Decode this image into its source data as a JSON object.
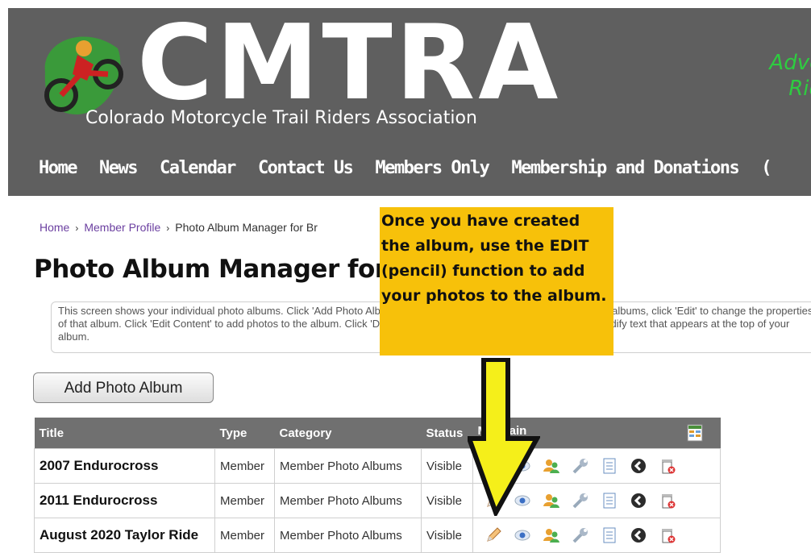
{
  "header": {
    "logo_text": "CMTRA",
    "logo_subtitle": "Colorado Motorcycle Trail Riders Association",
    "tagline_line1": "Advo",
    "tagline_line2": "Rid",
    "colors": {
      "header_bg": "#5f5f5f",
      "tagline": "#2ecc40"
    }
  },
  "nav": {
    "items": [
      "Home",
      "News",
      "Calendar",
      "Contact Us",
      "Members Only",
      "Membership and Donations",
      "("
    ]
  },
  "breadcrumb": {
    "home": "Home",
    "profile": "Member Profile",
    "current": "Photo Album Manager for Br"
  },
  "page_title": "Photo Album Manager for B",
  "description": "This screen shows your individual photo albums. Click 'Add Photo Album' to add a new photo album. In the list of photo albums, click 'Edit' to change the properties of that album. Click 'Edit Content' to add photos to the album. Click 'Delete' to delete an album. Click 'Description' to modify text that appears at the top of your album.",
  "callout": {
    "text": "Once you have created the album, use the EDIT (pencil) function to add your photos to the album.",
    "color": "#f7c10a"
  },
  "add_button": "Add Photo Album",
  "table": {
    "headers": {
      "title": "Title",
      "type": "Type",
      "category": "Category",
      "status": "Status",
      "maintain": "Maintain"
    },
    "rows": [
      {
        "title": "2007 Endurocross",
        "type": "Member",
        "category": "Member Photo Albums",
        "status": "Visible"
      },
      {
        "title": "2011 Endurocross",
        "type": "Member",
        "category": "Member Photo Albums",
        "status": "Visible"
      },
      {
        "title": "August 2020 Taylor Ride",
        "type": "Member",
        "category": "Member Photo Albums",
        "status": "Visible"
      }
    ]
  },
  "icons": [
    "edit-pencil-icon",
    "view-eye-icon",
    "permissions-users-icon",
    "settings-wrench-icon",
    "description-page-icon",
    "share-icon",
    "delete-trash-icon"
  ]
}
